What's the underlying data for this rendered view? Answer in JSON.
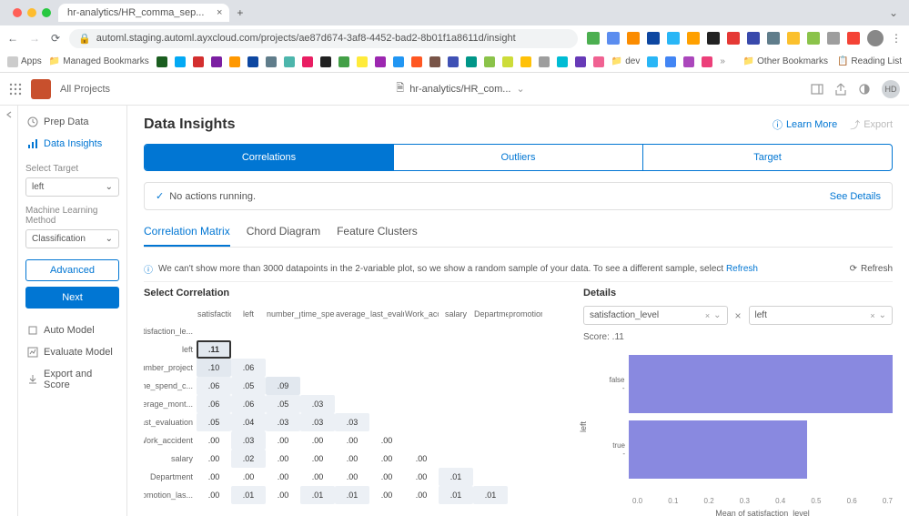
{
  "browser": {
    "tab_title": "hr-analytics/HR_comma_sep...",
    "url": "automl.staging.automl.ayxcloud.com/projects/ae87d674-3af8-4452-bad2-8b01f1a8611d/insight",
    "bookmarks": {
      "apps": "Apps",
      "managed": "Managed Bookmarks",
      "other": "Other Bookmarks",
      "reading": "Reading List"
    }
  },
  "appbar": {
    "all_projects": "All Projects",
    "doc_name": "hr-analytics/HR_com...",
    "avatar": "HD"
  },
  "sidebar": {
    "prep": "Prep Data",
    "insights": "Data Insights",
    "target_label": "Select Target",
    "target_value": "left",
    "method_label": "Machine Learning Method",
    "method_value": "Classification",
    "advanced": "Advanced",
    "next": "Next",
    "auto_model": "Auto Model",
    "evaluate": "Evaluate Model",
    "export": "Export and Score"
  },
  "main": {
    "title": "Data Insights",
    "learn_more": "Learn More",
    "export": "Export",
    "seg": {
      "correlations": "Correlations",
      "outliers": "Outliers",
      "target": "Target"
    },
    "status": {
      "msg": "No actions running.",
      "details": "See Details"
    },
    "subtabs": {
      "matrix": "Correlation Matrix",
      "chord": "Chord Diagram",
      "clusters": "Feature Clusters"
    },
    "warn": {
      "text": "We can't show more than 3000 datapoints in the 2-variable plot, so we show a random sample of your data. To see a different sample, select ",
      "refresh_link": "Refresh",
      "refresh_btn": "Refresh"
    },
    "select_corr": "Select Correlation"
  },
  "matrix": {
    "cols": [
      "satisfactio...",
      "left",
      "number_pr...",
      "time_spend...",
      "average_m...",
      "last_evalua...",
      "Work_acci...",
      "salary",
      "Department",
      "promotion_..."
    ],
    "rows": [
      "satisfaction_le...",
      "left",
      "number_project",
      "time_spend_c...",
      "average_mont...",
      "last_evaluation",
      "Work_accident",
      "salary",
      "Department",
      "promotion_las..."
    ],
    "cells": {
      "1_0": ".11",
      "2_0": ".10",
      "2_1": ".06",
      "3_0": ".06",
      "3_1": ".05",
      "3_2": ".09",
      "4_0": ".06",
      "4_1": ".06",
      "4_2": ".05",
      "4_3": ".03",
      "5_0": ".05",
      "5_1": ".04",
      "5_2": ".03",
      "5_3": ".03",
      "5_4": ".03",
      "6_0": ".00",
      "6_1": ".03",
      "6_2": ".00",
      "6_3": ".00",
      "6_4": ".00",
      "6_5": ".00",
      "7_0": ".00",
      "7_1": ".02",
      "7_2": ".00",
      "7_3": ".00",
      "7_4": ".00",
      "7_5": ".00",
      "7_6": ".00",
      "8_0": ".00",
      "8_1": ".00",
      "8_2": ".00",
      "8_3": ".00",
      "8_4": ".00",
      "8_5": ".00",
      "8_6": ".00",
      "8_7": ".01",
      "9_0": ".00",
      "9_1": ".01",
      "9_2": ".00",
      "9_3": ".01",
      "9_4": ".01",
      "9_5": ".00",
      "9_6": ".00",
      "9_7": ".01",
      "9_8": ".01"
    }
  },
  "details": {
    "title": "Details",
    "sel1": "satisfaction_level",
    "sel2": "left",
    "score_label": "Score: .11"
  },
  "chart_data": {
    "type": "bar",
    "orientation": "horizontal",
    "categories": [
      "false",
      "true"
    ],
    "values": [
      0.67,
      0.44
    ],
    "xlabel": "Mean of satisfaction_level",
    "ylabel": "left",
    "xlim": [
      0,
      0.7
    ],
    "xticks": [
      "0.0",
      "0.1",
      "0.2",
      "0.3",
      "0.4",
      "0.5",
      "0.6",
      "0.7"
    ]
  }
}
